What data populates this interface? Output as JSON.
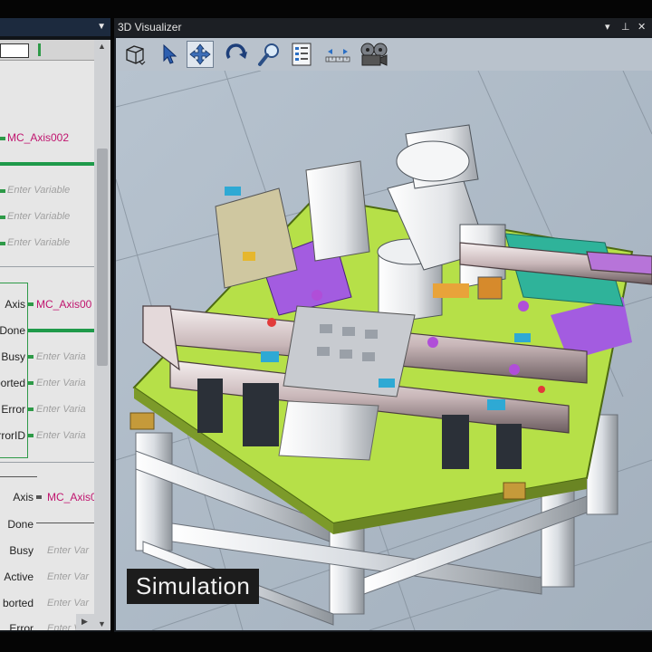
{
  "window": {
    "title": "3D Visualizer"
  },
  "ladder": {
    "rung1": {
      "axis_var": "MC_Axis002",
      "inputs": [
        "Enter Variable",
        "Enter Variable",
        "Enter Variable"
      ]
    },
    "fb1": {
      "pins": [
        "Axis",
        "Done",
        "Busy",
        "borted",
        "Error",
        "rrorID"
      ],
      "values": [
        "MC_Axis00",
        "",
        "Enter Varia",
        "Enter Varia",
        "Enter Varia",
        "Enter Varia"
      ]
    },
    "fb2": {
      "pins": [
        "Axis",
        "Done",
        "Busy",
        "Active",
        "borted",
        "Error"
      ],
      "values": [
        "MC_Axis0",
        "",
        "Enter Var",
        "Enter Var",
        "Enter Var",
        "Enter Var"
      ]
    }
  },
  "toolbar": {
    "tools": [
      "view-cube-icon",
      "select-arrow-icon",
      "pan-icon",
      "rotate-icon",
      "zoom-icon",
      "properties-icon",
      "fit-view-icon",
      "camera-reel-icon"
    ],
    "active_tool": "pan-icon"
  },
  "scene": {
    "caption": "Simulation"
  },
  "colors": {
    "rung": "#1f9a4a",
    "variable": "#c0146e",
    "floor": "#adb9c6",
    "table_top": "#b6e048"
  }
}
